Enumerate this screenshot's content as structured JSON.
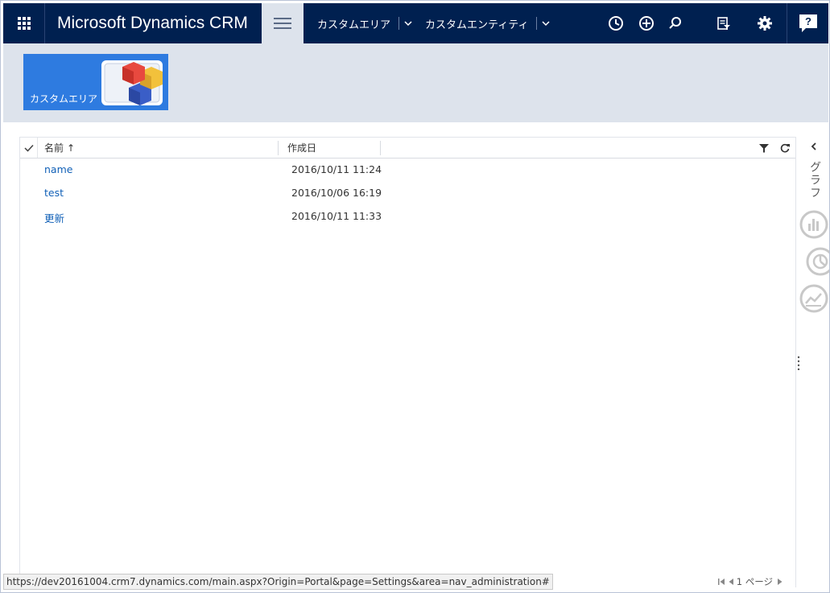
{
  "app": {
    "title": "Microsoft Dynamics CRM"
  },
  "nav": {
    "area_label": "カスタムエリア",
    "entity_label": "カスタムエンティティ"
  },
  "band": {
    "tile_label": "カスタムエリア"
  },
  "grid": {
    "columns": {
      "name": "名前",
      "created": "作成日"
    },
    "sort_indicator": "↑",
    "rows": [
      {
        "name": "name",
        "created": "2016/10/11 11:24"
      },
      {
        "name": "test",
        "created": "2016/10/06 16:19"
      },
      {
        "name": "更新",
        "created": "2016/10/11 11:33"
      }
    ]
  },
  "rail": {
    "label": "グラフ"
  },
  "pager": {
    "page_text": "1 ページ"
  },
  "status": {
    "url": "https://dev20161004.crm7.dynamics.com/main.aspx?Origin=Portal&page=Settings&area=nav_administration#"
  },
  "icons": {
    "app_launcher": "waffle-icon",
    "nav_toggle": "hamburger-icon",
    "recent": "clock-icon",
    "create": "plus-circle-icon",
    "search": "search-icon",
    "advanced_find": "filter-list-icon",
    "settings": "gear-icon",
    "help": "help-icon"
  },
  "colors": {
    "nav_bar": "#002050",
    "band": "#dde3ec",
    "tile": "#2e7be0",
    "link": "#1160b7"
  }
}
